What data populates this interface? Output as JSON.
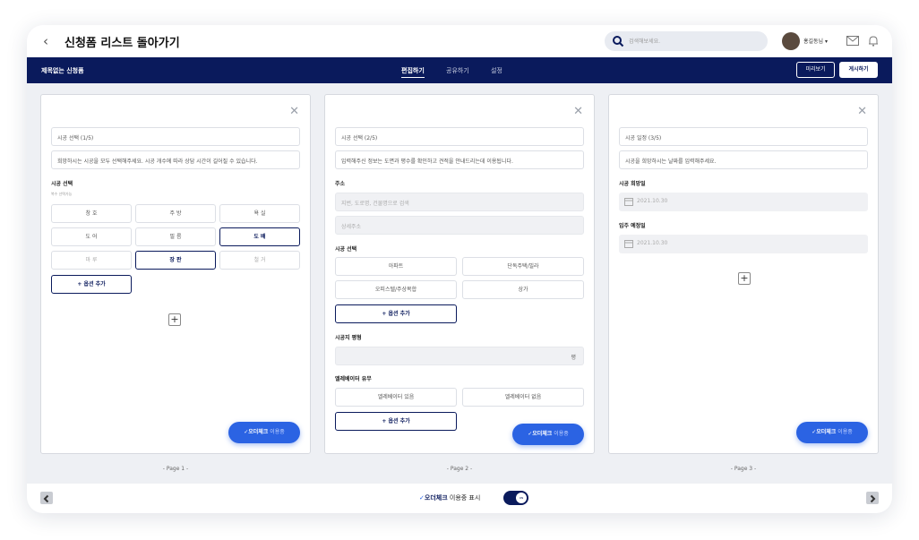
{
  "header": {
    "back_title": "신청폼 리스트 돌아가기",
    "search_placeholder": "검색해보세요.",
    "user_name": "홍길동님 ▾"
  },
  "nav": {
    "doc_title": "제목없는 신청폼",
    "tabs": [
      "편집하기",
      "공유하기",
      "설정"
    ],
    "active_tab": "편집하기",
    "preview_label": "미리보기",
    "publish_label": "게시하기"
  },
  "cards": {
    "page1": {
      "title_field": "시공 선택 (1/5)",
      "desc_field": "희망하시는 시공을 모두 선택해주세요. 시공 개수에 따라 상담 시간이 길어질 수 있습니다.",
      "section_label": "시공 선택",
      "section_sub": "복수 선택가능",
      "options": [
        "창 호",
        "주 방",
        "욕 실",
        "도 어",
        "필 름",
        "도 배",
        "마 루",
        "장 판",
        "철 거"
      ],
      "selected": [
        "도 배",
        "장 판"
      ],
      "add_option": "+ 옵션 추가",
      "pill_bold": "✓오더체크",
      "pill_light": "이용중",
      "page_label": "- Page 1 -"
    },
    "page2": {
      "title_field": "시공 선택 (2/5)",
      "desc_field": "입력해주신 정보는 도면과 평수를 확인하고 견적을 안내드리는데 이용됩니다.",
      "address_label": "주소",
      "address_ph1": "지번, 도로명, 건물명으로 검색",
      "address_ph2": "상세주소",
      "section_label": "시공 선택",
      "options": [
        "아파트",
        "단독주택/빌라",
        "오피스텔/주상복합",
        "상가"
      ],
      "add_option": "+ 옵션 추가",
      "area_label": "시공지 평형",
      "area_unit": "평",
      "elevator_label": "엘레베이터 유무",
      "elevator_options": [
        "엘레베이터 있음",
        "엘레베이터 없음"
      ],
      "add_option2": "+ 옵션 추가",
      "pill_bold": "✓오더체크",
      "pill_light": "이용중",
      "page_label": "- Page 2 -"
    },
    "page3": {
      "title_field": "시공 일정 (3/5)",
      "desc_field": "시공을 희망하시는 날짜를 입력해주세요.",
      "date1_label": "시공 희망일",
      "date1_value": "2021.10.30",
      "date2_label": "입주 예정일",
      "date2_value": "2021.10.30",
      "pill_bold": "✓오더체크",
      "pill_light": "이용중",
      "page_label": "- Page 3 -"
    }
  },
  "footer": {
    "check": "✓",
    "brand": "오더체크",
    "text": "이용중 표시",
    "toggle_text": "ON",
    "toggle_on": true
  },
  "colors": {
    "navy": "#0a1a5c",
    "accent_blue": "#2b63e3"
  }
}
